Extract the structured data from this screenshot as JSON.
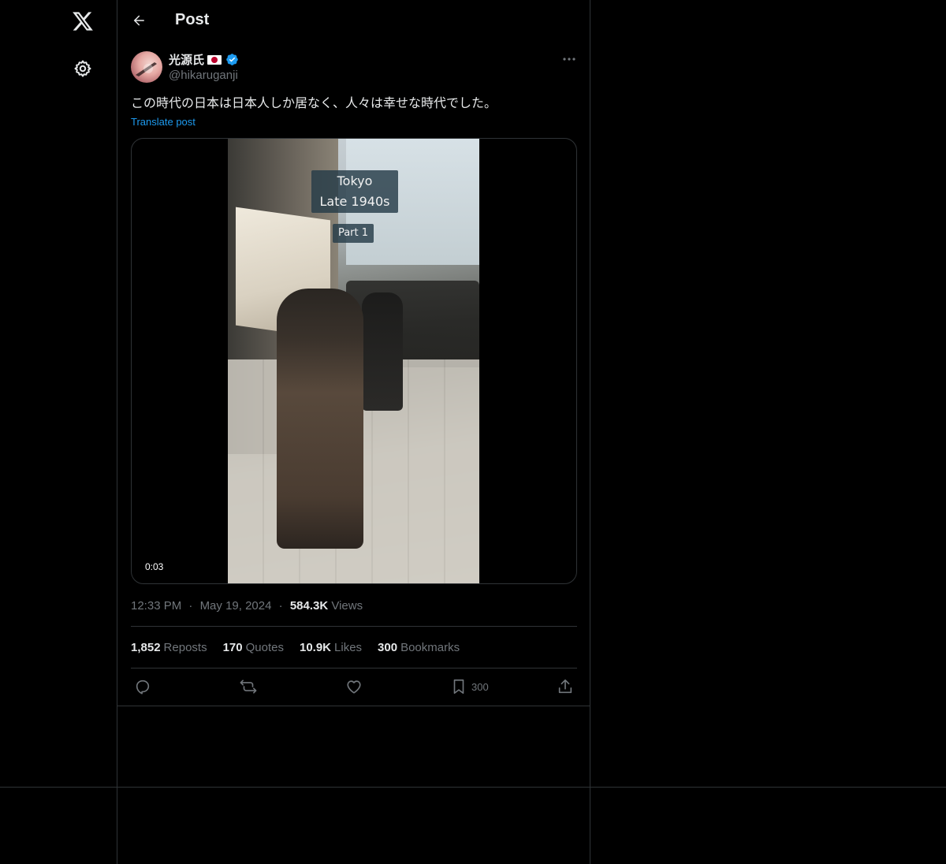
{
  "header": {
    "title": "Post"
  },
  "post": {
    "author": {
      "name": "光源氏",
      "handle": "@hikaruganji"
    },
    "text": "この時代の日本は日本人しか居なく、人々は幸せな時代でした。",
    "translate_label": "Translate post",
    "media": {
      "overlay_title_line1": "Tokyo",
      "overlay_title_line2": "Late 1940s",
      "overlay_part": "Part 1",
      "duration": "0:03"
    },
    "meta": {
      "time": "12:33 PM",
      "separator": "·",
      "date": "May 19, 2024",
      "views_count": "584.3K",
      "views_label": "Views"
    },
    "stats": {
      "reposts": {
        "count": "1,852",
        "label": "Reposts"
      },
      "quotes": {
        "count": "170",
        "label": "Quotes"
      },
      "likes": {
        "count": "10.9K",
        "label": "Likes"
      },
      "bookmarks": {
        "count": "300",
        "label": "Bookmarks"
      }
    },
    "actions": {
      "bookmark_count": "300"
    }
  },
  "icons": [
    "x-logo-icon",
    "gear-icon",
    "back-arrow-icon",
    "verified-badge-icon",
    "more-icon",
    "reply-icon",
    "repost-icon",
    "like-icon",
    "bookmark-icon",
    "share-icon"
  ],
  "colors": {
    "background": "#000000",
    "text": "#e7e9ea",
    "muted": "#71767b",
    "accent": "#1d9bf0",
    "border": "#2f3336"
  }
}
